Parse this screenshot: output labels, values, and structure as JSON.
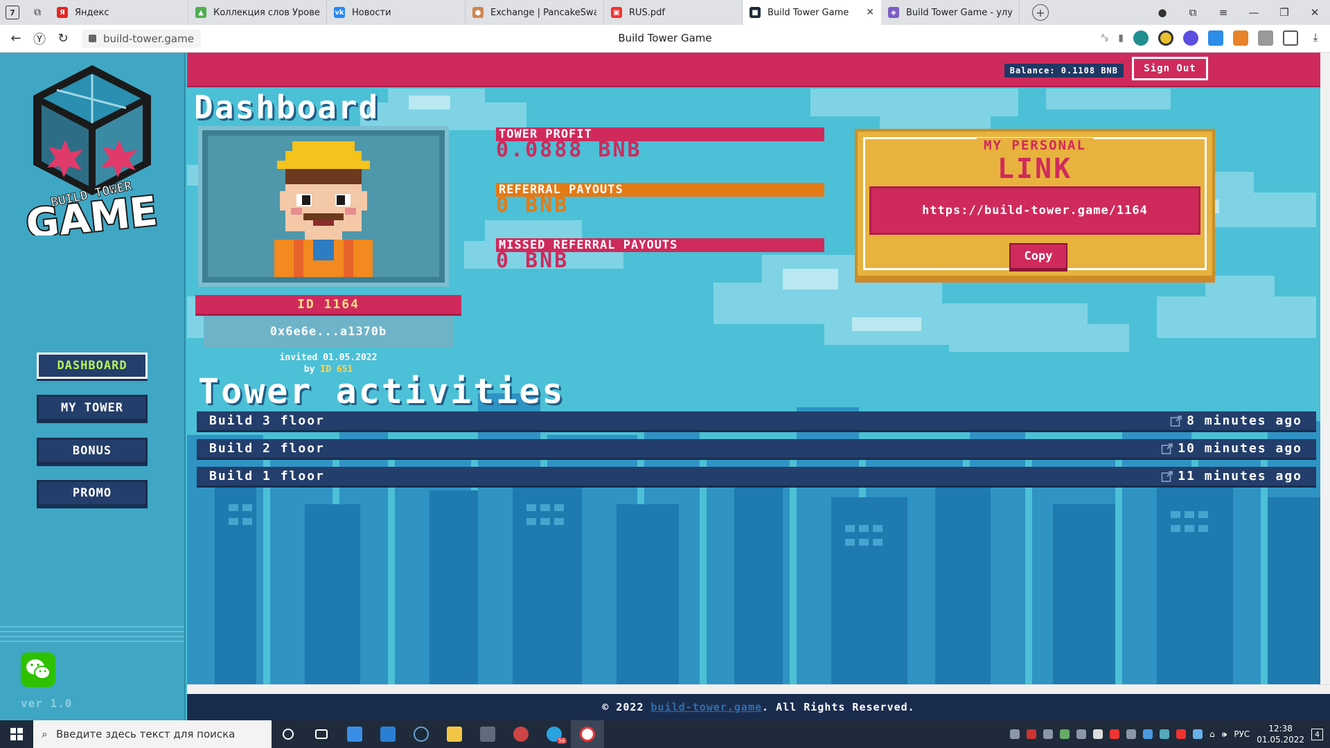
{
  "browser": {
    "tabs": [
      {
        "label": "Яндекс",
        "color": "#e52620",
        "glyph": "Я"
      },
      {
        "label": "Коллекция слов Уровень",
        "color": "#4caf50",
        "glyph": "▲"
      },
      {
        "label": "Новости",
        "color": "#2787f5",
        "glyph": "vk"
      },
      {
        "label": "Exchange | PancakeSwap",
        "color": "#d1884f",
        "glyph": "●"
      },
      {
        "label": "RUS.pdf",
        "color": "#e33",
        "glyph": "▣"
      },
      {
        "label": "Build Tower Game",
        "color": "#1f2b3a",
        "glyph": "■",
        "active": true
      },
      {
        "label": "Build Tower Game - улучш",
        "color": "#7b5cc4",
        "glyph": "◈"
      }
    ],
    "url": "build-tower.game",
    "page_title": "Build Tower Game",
    "tab_counter": "7"
  },
  "header": {
    "balance": "Balance: 0.1108 BNB",
    "sign_out": "Sign Out"
  },
  "sidebar": {
    "nav": [
      {
        "label": "DASHBOARD",
        "active": true
      },
      {
        "label": "MY TOWER"
      },
      {
        "label": "BONUS"
      },
      {
        "label": "PROMO"
      }
    ],
    "version": "ver 1.0",
    "logo_text_top": "BUILD TOWER",
    "logo_text_bottom": "GAME"
  },
  "dashboard": {
    "title": "Dashboard",
    "user": {
      "id": "ID 1164",
      "address": "0x6e6e...a1370b",
      "invited": "invited 01.05.2022",
      "by": "by",
      "ref_id": "ID 651"
    },
    "stats": [
      {
        "label": "TOWER PROFIT",
        "value": "0.0888 BNB",
        "label_bg": "#cf2a5c",
        "value_color": "#cf2a5c"
      },
      {
        "label": "REFERRAL PAYOUTS",
        "value": "0 BNB",
        "label_bg": "#e47a15",
        "value_color": "#e47a15"
      },
      {
        "label": "MISSED REFERRAL PAYOUTS",
        "value": "0 BNB",
        "label_bg": "#cf2a5c",
        "value_color": "#cf2a5c"
      }
    ],
    "link": {
      "small": "MY PERSONAL",
      "big": "LINK",
      "url": "https://build-tower.game/1164",
      "copy": "Copy"
    }
  },
  "activities": {
    "title": "Tower activities",
    "items": [
      {
        "text": "Build 3 floor",
        "time": "8 minutes ago"
      },
      {
        "text": "Build 2 floor",
        "time": "10 minutes ago"
      },
      {
        "text": "Build 1 floor",
        "time": "11 minutes ago"
      }
    ]
  },
  "footer": {
    "prefix": "© 2022",
    "link": "build-tower.game",
    "suffix": ". All Rights Reserved."
  },
  "taskbar": {
    "search_placeholder": "Введите здесь текст для поиска",
    "lang": "РУС",
    "time": "12:38",
    "date": "01.05.2022",
    "notifications": "4",
    "telegram_badge": "56"
  }
}
